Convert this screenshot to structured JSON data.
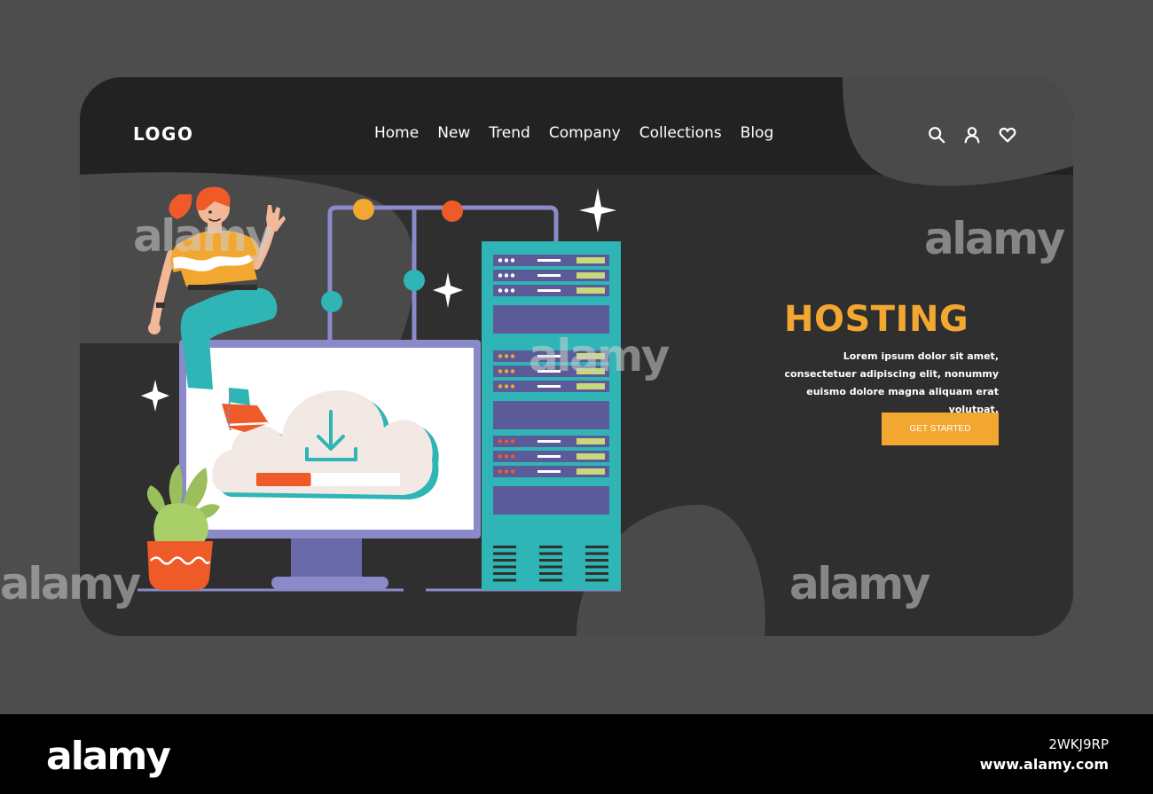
{
  "header": {
    "logo": "LOGO",
    "nav": [
      "Home",
      "New",
      "Trend",
      "Company",
      "Collections",
      "Blog"
    ],
    "icons": [
      "search-icon",
      "user-icon",
      "heart-icon"
    ]
  },
  "hero": {
    "title": "HOSTING",
    "text": "Lorem ipsum dolor sit amet, consectetuer adipiscing elit, nonummy euismo dolore magna aliquam erat volutpat.",
    "cta": "GET STARTED"
  },
  "download_progress": 0.38,
  "watermark": "alamy",
  "footer": {
    "brand": "alamy",
    "image_id": "2WKJ9RP",
    "url": "www.alamy.com"
  },
  "colors": {
    "page_bg": "#4d4d4d",
    "card_bg": "#2f2f2f",
    "accent": "#f2a730",
    "teal": "#2fb5b5",
    "server_slot": "#5b5b9a",
    "monitor_frame": "#8a8ac8",
    "cloud": "#f2e8e4",
    "progress_fill": "#ee5a28"
  }
}
